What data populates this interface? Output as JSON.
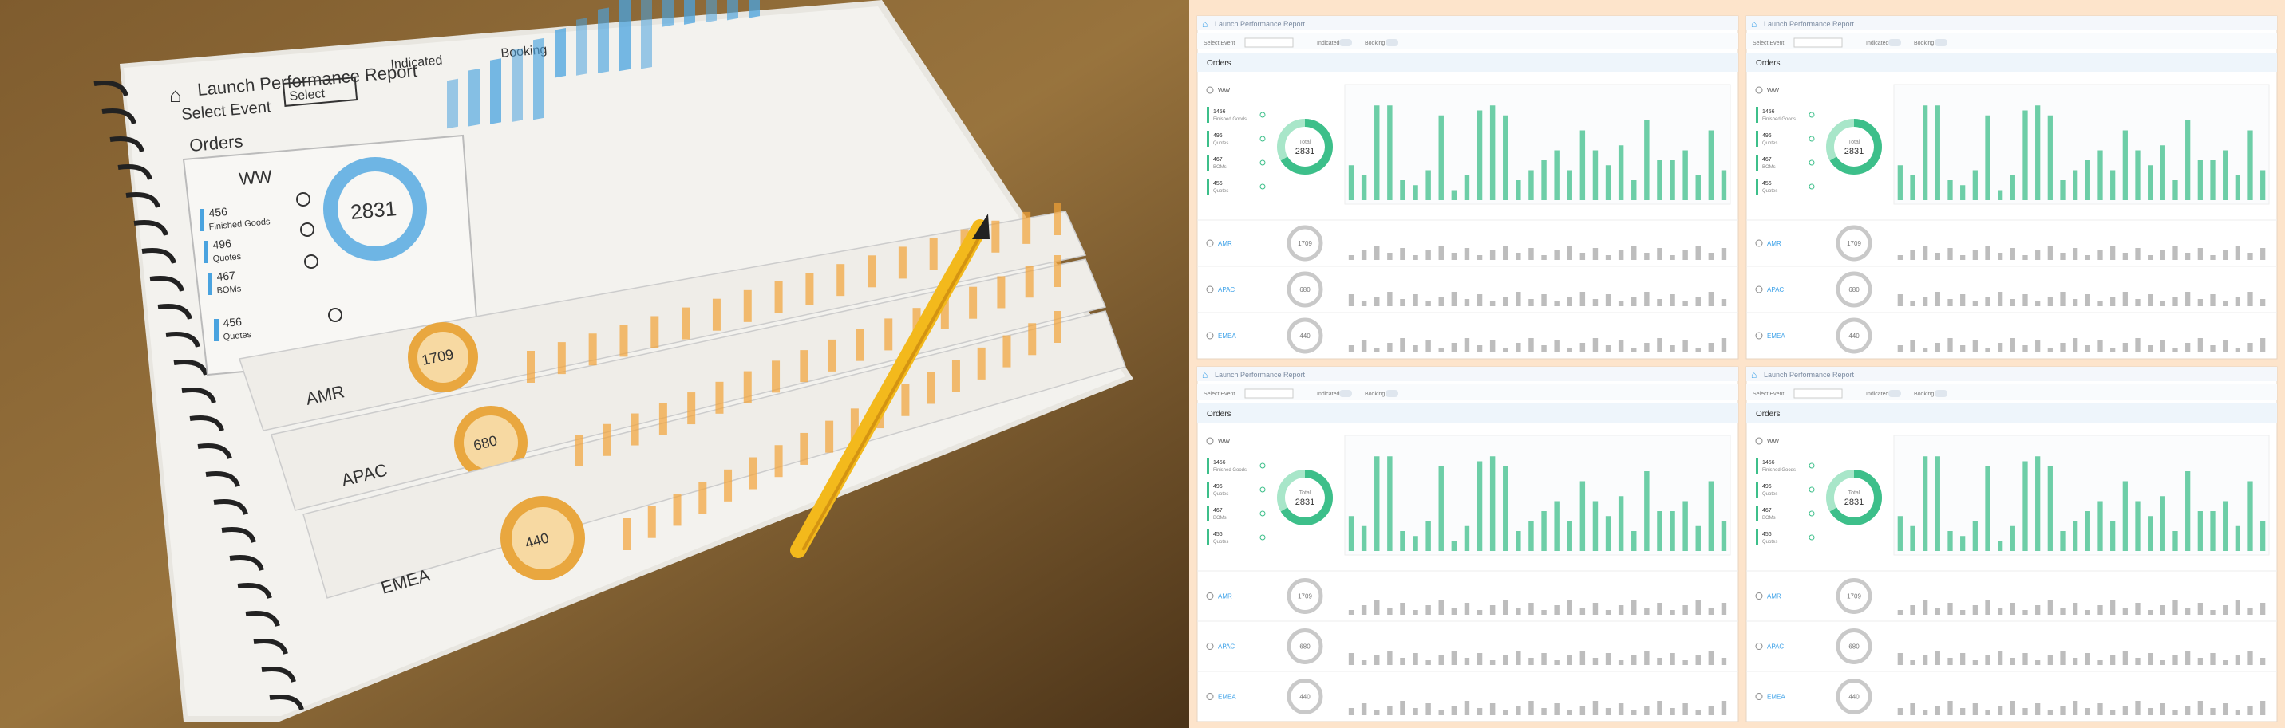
{
  "sketch": {
    "title": "Launch Performance Report",
    "select_label": "Select Event",
    "select_value": "Select",
    "toggle_1": "Indicated",
    "toggle_2": "Booking",
    "section_title": "Orders",
    "regions": [
      "WW",
      "AMR",
      "APAC",
      "EMEA"
    ],
    "ww_stats": [
      {
        "value": "456",
        "label": "Finished Goods"
      },
      {
        "value": "496",
        "label": "Quotes"
      },
      {
        "value": "467",
        "label": "BOMs"
      },
      {
        "value": "456",
        "label": "Quotes"
      }
    ],
    "ww_total": "2831",
    "amr_total": "1709",
    "apac_total": "680",
    "emea_total": "440",
    "total_label": "Total"
  },
  "mockups": {
    "app_title": "Launch Performance Report",
    "select_event_label": "Select Event",
    "indicated_label": "Indicated",
    "booking_label": "Booking",
    "section_title": "Orders",
    "regions": [
      "WW",
      "AMR",
      "APAC",
      "EMEA"
    ],
    "ww_stats": [
      {
        "value": "1456",
        "label": "Finished Goods"
      },
      {
        "value": "496",
        "label": "Quotes"
      },
      {
        "value": "467",
        "label": "BOMs"
      },
      {
        "value": "456",
        "label": "Quotes"
      }
    ],
    "donut_center_label": "Total",
    "ww_total": "2831",
    "amr_total": "1709",
    "apac_total": "680",
    "emea_total": "440",
    "bar_values": [
      0.35,
      0.25,
      0.95,
      0.95,
      0.2,
      0.15,
      0.3,
      0.85,
      0.1,
      0.25,
      0.9,
      0.95,
      0.85,
      0.2,
      0.3,
      0.4,
      0.5,
      0.3,
      0.7,
      0.5,
      0.35,
      0.55,
      0.2,
      0.8,
      0.4,
      0.4,
      0.5,
      0.25,
      0.7,
      0.3
    ],
    "colors": {
      "background": "#fde4cb",
      "accent": "#3dbf8a",
      "accent_light": "#a8e6c9",
      "blue_link": "#3aa0e8",
      "gray": "#c9c9c9"
    }
  }
}
